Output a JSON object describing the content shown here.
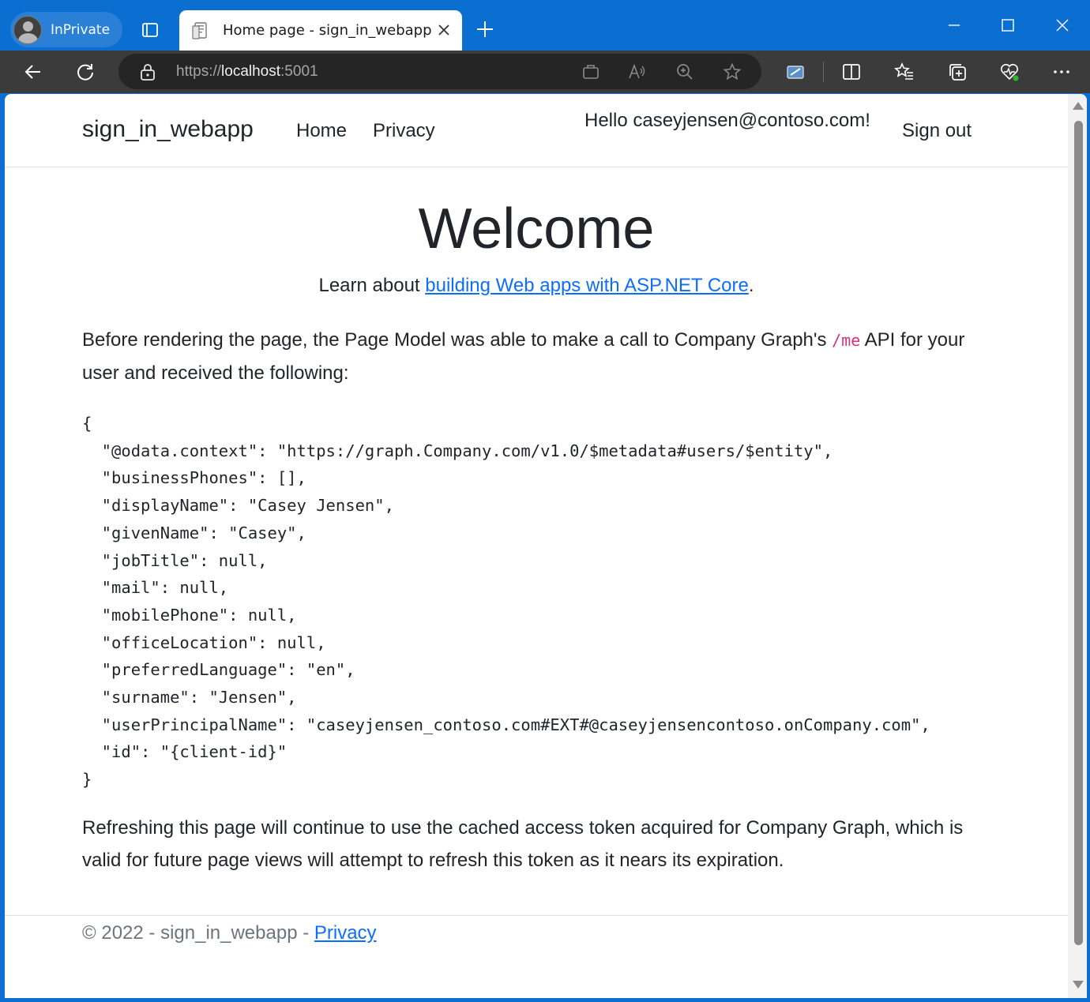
{
  "browser": {
    "inprivate_label": "InPrivate",
    "tab_title": "Home page - sign_in_webapp",
    "url_scheme": "https://",
    "url_host": "localhost",
    "url_port": ":5001"
  },
  "nav": {
    "brand": "sign_in_webapp",
    "links": [
      "Home",
      "Privacy"
    ],
    "greeting": "Hello caseyjensen@contoso.com!",
    "signout": "Sign out"
  },
  "main": {
    "heading": "Welcome",
    "learn_prefix": "Learn about ",
    "learn_link": "building Web apps with ASP.NET Core",
    "learn_suffix": ".",
    "intro_before": "Before rendering the page, the Page Model was able to make a call to Company Graph's ",
    "intro_code": "/me",
    "intro_after": " API for your user and received the following:",
    "json_lines": [
      "{",
      "  \"@odata.context\": \"https://graph.Company.com/v1.0/$metadata#users/$entity\",",
      "  \"businessPhones\": [],",
      "  \"displayName\": \"Casey Jensen\",",
      "  \"givenName\": \"Casey\",",
      "  \"jobTitle\": null,",
      "  \"mail\": null,",
      "  \"mobilePhone\": null,",
      "  \"officeLocation\": null,",
      "  \"preferredLanguage\": \"en\",",
      "  \"surname\": \"Jensen\",",
      "  \"userPrincipalName\": \"caseyjensen_contoso.com#EXT#@caseyjensencontoso.onCompany.com\",",
      "  \"id\": \"{client-id}\"",
      "}"
    ],
    "refresh_text": "Refreshing this page will continue to use the cached access token acquired for Company Graph, which is valid for future page views will attempt to refresh this token as it nears its expiration."
  },
  "footer": {
    "copyright": "© 2022 - sign_in_webapp - ",
    "privacy_link": "Privacy"
  },
  "colors": {
    "titlebar": "#0b6fd1",
    "toolbar": "#3b3b3b",
    "link": "#0d6efd",
    "code": "#d63384"
  }
}
